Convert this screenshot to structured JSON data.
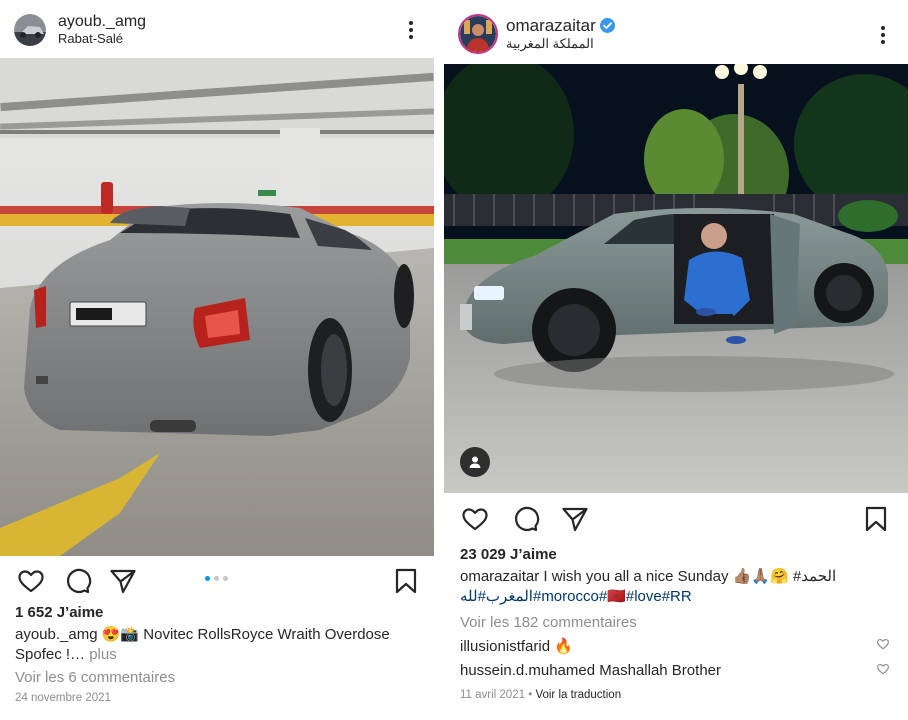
{
  "left_post": {
    "username": "ayoub._amg",
    "location": "Rabat-Salé",
    "likes": "1 652 J’aime",
    "caption_user": "ayoub._amg",
    "caption_emojis": "😍📸",
    "caption_text": "Novitec RollsRoyce Wraith Overdose",
    "caption_text_2": "Spofec !…",
    "more_label": "plus",
    "view_comments": "Voir les 6 commentaires",
    "date": "24 novembre 2021",
    "carousel": {
      "count": 3,
      "active_index": 0
    }
  },
  "right_post": {
    "username": "omarazaitar",
    "location": "المملكة المغربية",
    "likes": "23 029 J’aime",
    "caption_user": "omarazaitar",
    "caption_text": "I wish you all a nice Sunday 👍🏽🙏🏽🤗",
    "caption_arabic": "#الحمد",
    "caption_line2_arabic": "المغرب#لله#",
    "caption_tags": "morocco#🇲🇦#love#RR",
    "view_comments": "Voir les 182 commentaires",
    "comments": [
      {
        "user": "illusionistfarid",
        "text": "🔥"
      },
      {
        "user": "hussein.d.muhamed",
        "text": "Mashallah Brother"
      }
    ],
    "date": "11 avril 2021",
    "separator": "•",
    "translate_label": "Voir la traduction"
  },
  "icons": {
    "like": "heart-icon",
    "comment": "comment-icon",
    "share": "paper-plane-icon",
    "save": "bookmark-icon",
    "more": "more-vertical-icon",
    "verified": "verified-badge-icon",
    "tag": "user-tag-icon"
  },
  "colors": {
    "text": "#262626",
    "muted": "#8e8e8e",
    "verified_blue": "#3897f0",
    "carousel_active": "#0095f6"
  }
}
